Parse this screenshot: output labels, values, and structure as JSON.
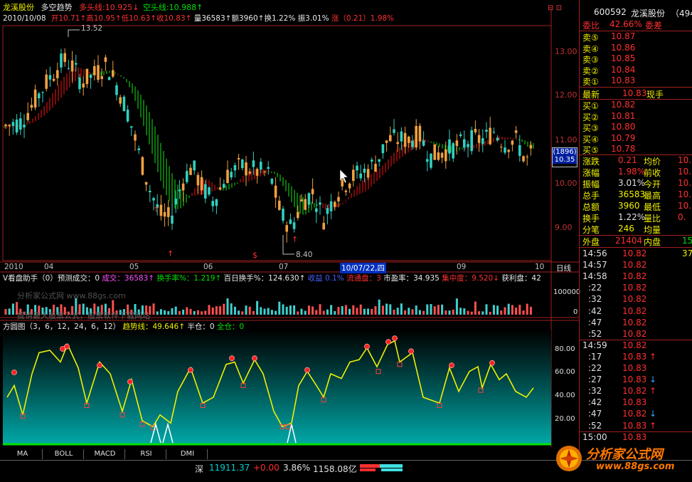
{
  "header": {
    "stock_name": "龙溪股份",
    "indicator": "多空趋势",
    "duo_label": "多头线:",
    "duo_value": "10.925",
    "kong_label": "空头线:",
    "kong_value": "10.988"
  },
  "bar_info": {
    "date": "2010/10/08",
    "open": "开10.71",
    "high": "高10.95",
    "low": "低10.63",
    "close": "收10.83",
    "vol": "量36583",
    "amount": "额3960",
    "turnover": "换1.22%",
    "amplitude": "振3.01%",
    "change": "涨（0.21）1.98%"
  },
  "price_axis": [
    "13.00",
    "12.00",
    "11.00",
    "10.00",
    "9.00"
  ],
  "high_mark": "13.52",
  "low_mark": "8.40",
  "crosshair_price": "(1896)",
  "crosshair_value": "10.35",
  "date_axis": [
    "2010",
    "04",
    "05",
    "06",
    "07",
    "09",
    "10"
  ],
  "date_cursor": "10/07/22,四",
  "period_label": "日线",
  "vol_header": {
    "title": "V看盘助手（0）预测成交：0",
    "chengjiao": "成交：36583",
    "huanshou": "换手率%：1.219",
    "bairi": "百日换手%：124.630",
    "shouyi": "收益 0.1%",
    "liutong": "流通盘：3",
    "shiying": "市盈率：34.935",
    "jizhong": "集中度：9.520",
    "huoli": "获利盘：42"
  },
  "vol_axis": [
    "100000",
    "0"
  ],
  "watermark1": "分析家公式网 www.88gs.com",
  "watermark2": "提请最大股票公式，股票软件下载网站",
  "osc_header": {
    "title": "方圆图（3，6，12，24，6，12）",
    "trend": "趋势线：49.646",
    "half": "半仓：0",
    "full": "全仓：0"
  },
  "osc_axis": [
    "80.00",
    "60.00",
    "40.00",
    "20.00"
  ],
  "tabs": [
    "MA",
    "BOLL",
    "MACD",
    "RSI",
    "DMI"
  ],
  "right_panel": {
    "code": "600592",
    "name": "龙溪股份",
    "extra": "（494",
    "webi_label": "委比",
    "webi_value": "42.66%",
    "weicha_label": "委差",
    "sell": [
      {
        "label": "卖⑤",
        "price": "10.87"
      },
      {
        "label": "卖④",
        "price": "10.86"
      },
      {
        "label": "卖③",
        "price": "10.85"
      },
      {
        "label": "卖②",
        "price": "10.84"
      },
      {
        "label": "卖①",
        "price": "10.83"
      }
    ],
    "latest_label": "最新",
    "latest_value": "10.83",
    "xianshou_label": "现手",
    "buy": [
      {
        "label": "买①",
        "price": "10.82"
      },
      {
        "label": "买②",
        "price": "10.81"
      },
      {
        "label": "买③",
        "price": "10.80"
      },
      {
        "label": "买④",
        "price": "10.79"
      },
      {
        "label": "买⑤",
        "price": "10.78"
      }
    ],
    "stats": [
      {
        "l1": "涨跌",
        "v1": "0.21",
        "l2": "均价",
        "v2": "10."
      },
      {
        "l1": "涨幅",
        "v1": "1.98%",
        "l2": "前收",
        "v2": "10."
      },
      {
        "l1": "振幅",
        "v1": "3.01%",
        "l2": "今开",
        "v2": "10."
      },
      {
        "l1": "总手",
        "v1": "36583",
        "l2": "最高",
        "v2": "10."
      },
      {
        "l1": "总额",
        "v1": "3960",
        "l2": "最低",
        "v2": "10."
      },
      {
        "l1": "换手",
        "v1": "1.22%",
        "l2": "量比",
        "v2": "0."
      },
      {
        "l1": "分笔",
        "v1": "246",
        "l2": "均量",
        "v2": ""
      }
    ],
    "waipan_label": "外盘",
    "waipan_value": "21404",
    "neipan_label": "内盘",
    "neipan_value": "15",
    "ticks": [
      {
        "time": "14:56",
        "price": "10.82",
        "vol": "37",
        "arrow": ""
      },
      {
        "time": "14:57",
        "price": "10.82",
        "vol": "",
        "arrow": ""
      },
      {
        "time": "14:58",
        "price": "10.82",
        "vol": "",
        "arrow": ""
      },
      {
        "time": ":22",
        "price": "10.82",
        "vol": "",
        "arrow": ""
      },
      {
        "time": ":32",
        "price": "10.82",
        "vol": "",
        "arrow": ""
      },
      {
        "time": ":42",
        "price": "10.82",
        "vol": "",
        "arrow": ""
      },
      {
        "time": ":47",
        "price": "10.82",
        "vol": "",
        "arrow": ""
      },
      {
        "time": ":52",
        "price": "10.82",
        "vol": "",
        "arrow": ""
      },
      {
        "time": "14:59",
        "price": "10.82",
        "vol": "",
        "arrow": ""
      },
      {
        "time": ":17",
        "price": "10.83",
        "vol": "",
        "arrow": "↑"
      },
      {
        "time": ":22",
        "price": "10.83",
        "vol": "",
        "arrow": ""
      },
      {
        "time": ":27",
        "price": "10.83",
        "vol": "",
        "arrow": "↓"
      },
      {
        "time": ":32",
        "price": "10.82",
        "vol": "",
        "arrow": "↑"
      },
      {
        "time": ":42",
        "price": "10.83",
        "vol": "",
        "arrow": ""
      },
      {
        "time": ":47",
        "price": "10.82",
        "vol": "",
        "arrow": "↓"
      },
      {
        "time": ":52",
        "price": "10.83",
        "vol": "",
        "arrow": "↑"
      },
      {
        "time": "15:00",
        "price": "10.83",
        "vol": "",
        "arrow": ""
      }
    ]
  },
  "status_bar": {
    "market": "深",
    "index": "11911.37",
    "change": "+0.00",
    "pct": "3.86%",
    "amount": "1158.08亿"
  },
  "logo_text": "分析家公式网",
  "logo_url": "www.88gs.com",
  "chart_data": {
    "type": "line",
    "title": "龙溪股份 多空趋势",
    "ylim": [
      8.4,
      13.6
    ],
    "series": [
      {
        "name": "多头线",
        "value": 10.925
      },
      {
        "name": "空头线",
        "value": 10.988
      }
    ]
  }
}
